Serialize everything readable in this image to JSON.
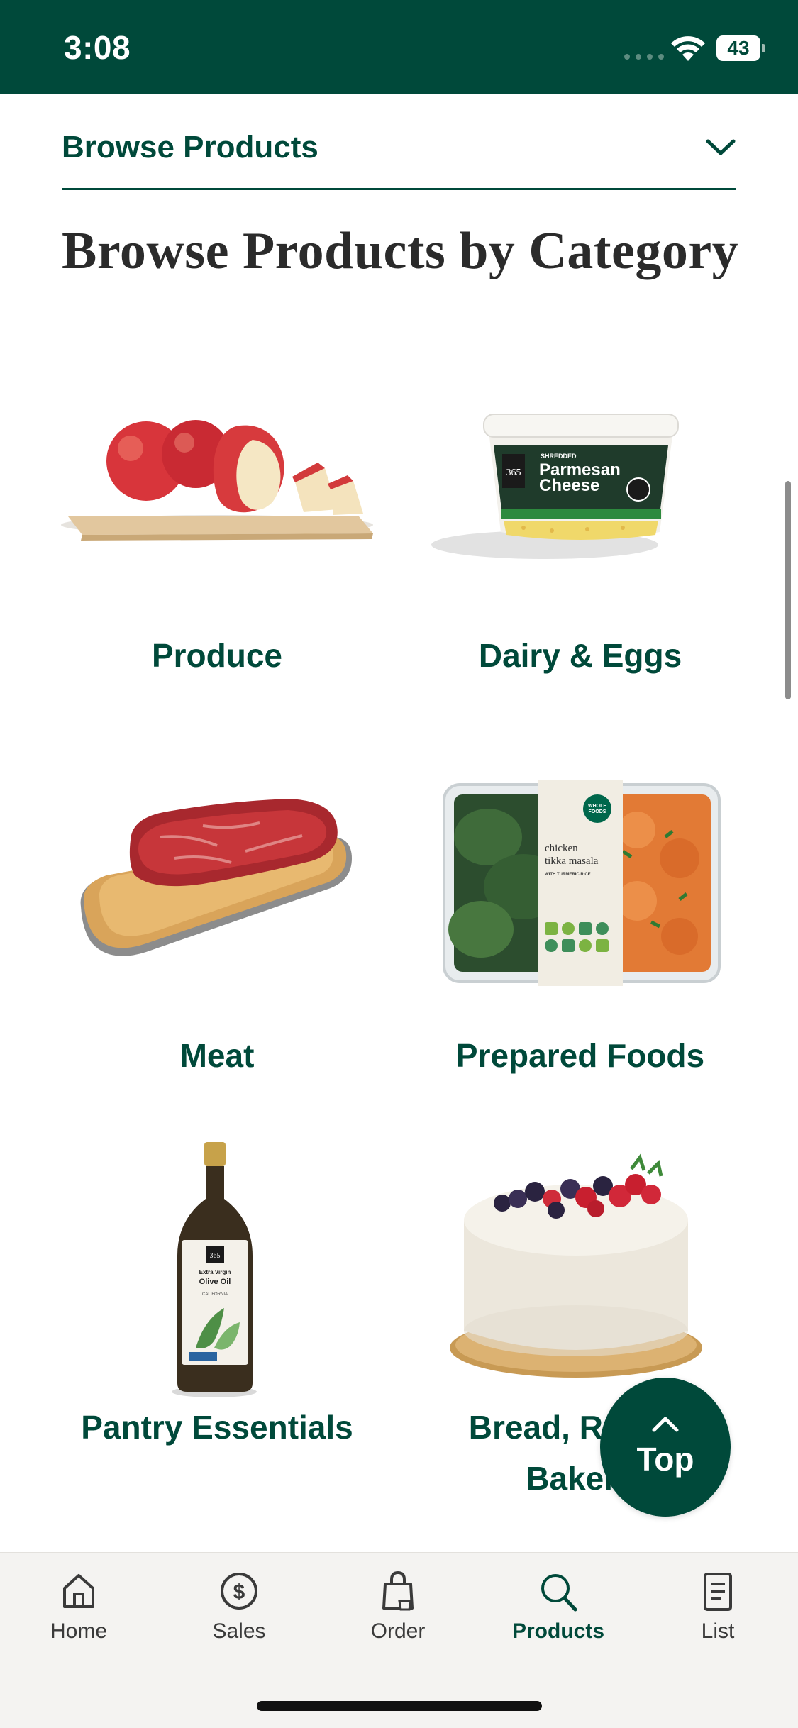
{
  "status_bar": {
    "time": "3:08",
    "battery": "43"
  },
  "browse": {
    "dropdown_label": "Browse Products"
  },
  "page": {
    "title": "Browse Products by Category"
  },
  "categories": [
    {
      "label": "Produce",
      "image": "apples-on-cutting-board"
    },
    {
      "label": "Dairy & Eggs",
      "image": "parmesan-cheese-tub"
    },
    {
      "label": "Meat",
      "image": "steak-on-board"
    },
    {
      "label": "Prepared Foods",
      "image": "chicken-tikka-masala-container"
    },
    {
      "label": "Pantry Essentials",
      "image": "olive-oil-bottle"
    },
    {
      "label": "Bread, Rolls & Bakery",
      "image": "frosted-cake-with-berries"
    }
  ],
  "product_text": {
    "cheese_brand": "365",
    "cheese_shredded": "SHREDDED",
    "cheese_name_1": "Parmesan",
    "cheese_name_2": "Cheese",
    "meal_brand_1": "WHOLE",
    "meal_brand_2": "FOODS",
    "meal_name_1": "chicken",
    "meal_name_2": "tikka masala",
    "meal_sub": "WITH TURMERIC RICE",
    "oil_brand": "365",
    "oil_name_1": "Extra Virgin",
    "oil_name_2": "Olive Oil",
    "oil_origin": "CALIFORNIA"
  },
  "top_button": {
    "label": "Top"
  },
  "tabs": [
    {
      "label": "Home",
      "icon": "home-icon",
      "active": false
    },
    {
      "label": "Sales",
      "icon": "dollar-circle-icon",
      "active": false
    },
    {
      "label": "Order",
      "icon": "shopping-bag-icon",
      "active": false
    },
    {
      "label": "Products",
      "icon": "search-icon",
      "active": true
    },
    {
      "label": "List",
      "icon": "list-document-icon",
      "active": false
    }
  ],
  "colors": {
    "brand_green": "#00493a",
    "tab_bar_bg": "#f4f3f1",
    "title_text": "#2b2b2b"
  }
}
